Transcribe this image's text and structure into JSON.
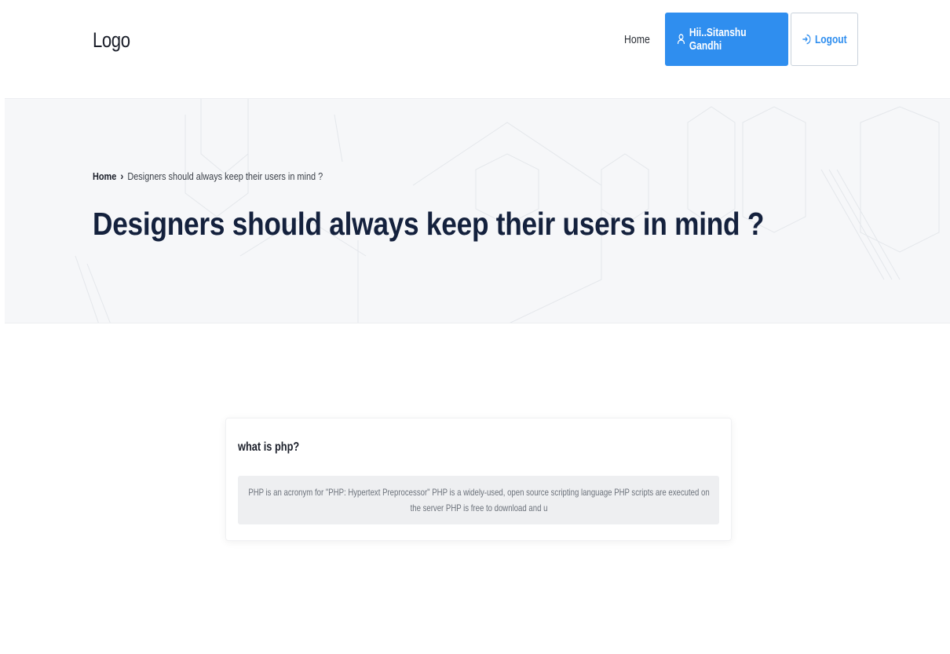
{
  "header": {
    "logo": "Logo",
    "nav_home": "Home",
    "user_label": "Hii..Sitanshu Gandhi",
    "logout_label": "Logout"
  },
  "hero": {
    "breadcrumb": {
      "home": "Home",
      "separator": "›",
      "current": "Designers should always keep their users in mind ?"
    },
    "title": "Designers should always keep their users in mind ?"
  },
  "card": {
    "title": "what is php?",
    "body": "PHP is an acronym for \"PHP: Hypertext Preprocessor\" PHP is a widely-used, open source scripting language PHP scripts are executed on the server PHP is free to download and u"
  },
  "icons": {
    "user": "user-icon",
    "logout": "logout-icon"
  },
  "colors": {
    "primary": "#2f8eef",
    "title": "#14213d",
    "hero_bg": "#f6f7f9"
  }
}
